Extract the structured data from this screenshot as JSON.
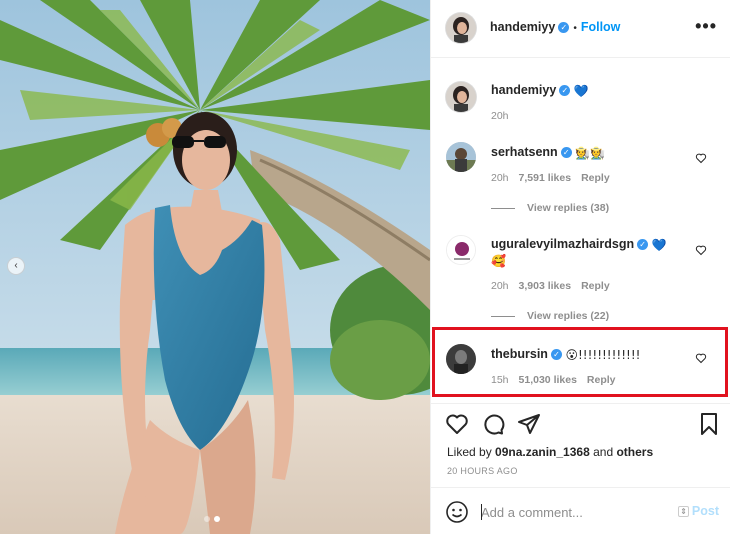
{
  "post": {
    "author": "handemiyy",
    "follow_label": "Follow",
    "more_label": "•••",
    "carousel": {
      "slides": 2,
      "active_slide": 2
    },
    "caption": {
      "username": "handemiyy",
      "emoji": "💙",
      "time": "20h"
    }
  },
  "comments": [
    {
      "username": "serhatsenn",
      "text": "🧑‍🌾🧑‍🌾",
      "time": "20h",
      "likes": "7,591 likes",
      "reply_label": "Reply",
      "view_replies": "View replies (38)"
    },
    {
      "username": "uguralevyilmazhairdsgn",
      "text": "💙",
      "text2": "🥰",
      "time": "20h",
      "likes": "3,903 likes",
      "reply_label": "Reply",
      "view_replies": "View replies (22)"
    },
    {
      "username": "thebursin",
      "text": "😮!!!!!!!!!!!!!",
      "time": "15h",
      "likes": "51,030 likes",
      "reply_label": "Reply"
    }
  ],
  "liked_by": {
    "prefix": "Liked by ",
    "user": "09na.zanin_1368",
    "middle": " and ",
    "others": "others"
  },
  "time_ago": "20 HOURS AGO",
  "add_comment": {
    "placeholder": "Add a comment...",
    "post_label": "Post"
  },
  "colors": {
    "accent": "#0095f6",
    "verified": "#3897f0",
    "highlight": "#e1121f"
  }
}
